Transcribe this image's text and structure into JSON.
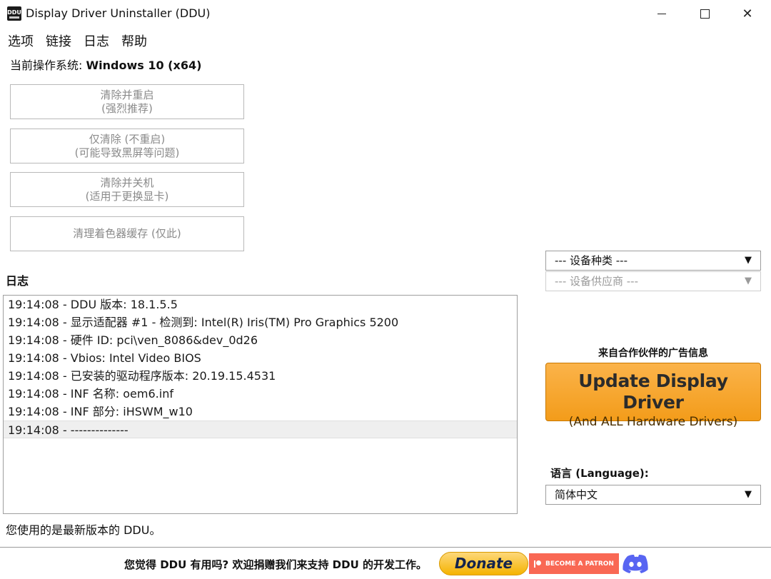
{
  "window": {
    "title": "Display Driver Uninstaller (DDU)",
    "icon_text": "DDU",
    "controls": {
      "minimize": "minimize-icon",
      "maximize": "maximize-icon",
      "close": "✕"
    }
  },
  "menu": [
    {
      "label": "选项"
    },
    {
      "label": "链接"
    },
    {
      "label": "日志"
    },
    {
      "label": "帮助"
    }
  ],
  "os": {
    "label": "当前操作系统:",
    "value": "Windows 10 (x64)"
  },
  "actions": [
    {
      "line1": "清除并重启",
      "line2": "(强烈推荐)"
    },
    {
      "line1": "仅清除 (不重启)",
      "line2": "(可能导致黑屏等问题)"
    },
    {
      "line1": "清除并关机",
      "line2": "(适用于更换显卡)"
    },
    {
      "line1": "清理着色器缓存 (仅此)",
      "line2": ""
    }
  ],
  "log": {
    "heading": "日志",
    "lines": [
      "19:14:08 - DDU 版本: 18.1.5.5",
      "19:14:08 - 显示适配器 #1 - 检测到: Intel(R) Iris(TM) Pro Graphics 5200",
      "19:14:08 - 硬件 ID: pci\\ven_8086&dev_0d26",
      "19:14:08 - Vbios: Intel Video BIOS",
      "19:14:08 - 已安装的驱动程序版本: 20.19.15.4531",
      "19:14:08 - INF 名称: oem6.inf",
      "19:14:08 - INF 部分: iHSWM_w10",
      "19:14:08 - --------------"
    ],
    "selected_index": 7
  },
  "status": "您使用的是最新版本的 DDU。",
  "device_type": {
    "value": "--- 设备种类 ---",
    "arrow": "▼"
  },
  "device_vendor": {
    "value": "--- 设备供应商 ---",
    "arrow": "▼"
  },
  "ad": {
    "title": "来自合作伙伴的广告信息",
    "line1": "Update Display Driver",
    "line2": "(And ALL Hardware Drivers)"
  },
  "language": {
    "label": "语言 (Language):",
    "value": "简体中文",
    "arrow": "▼"
  },
  "footer": {
    "text": "您觉得 DDU 有用吗? 欢迎捐赠我们来支持 DDU 的开发工作。",
    "donate": "Donate",
    "patreon": "BECOME A PATRON"
  },
  "colors": {
    "ad_orange": "#f5a623",
    "donate_yellow": "#f5b300",
    "patreon": "#f96854",
    "discord": "#5865f2"
  }
}
